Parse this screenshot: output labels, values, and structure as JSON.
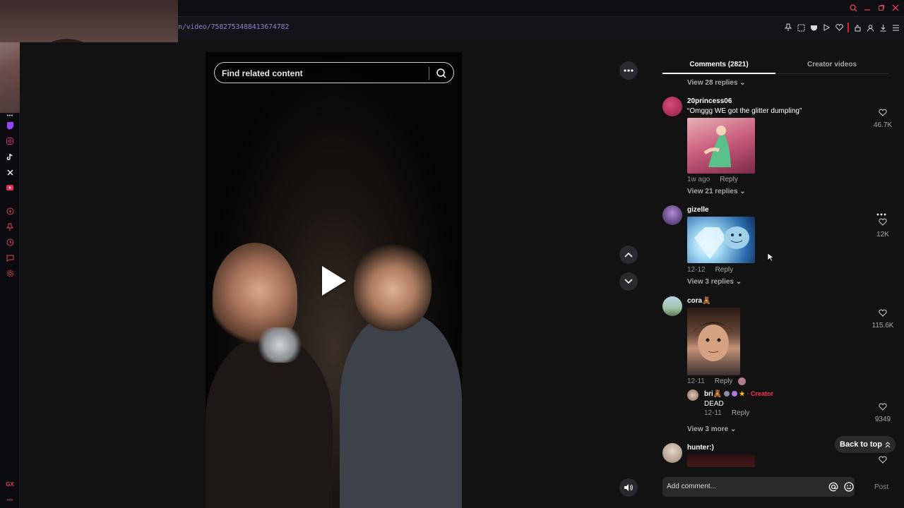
{
  "browser": {
    "url": "n/video/7582753488413674782"
  },
  "search": {
    "placeholder": "Find related content"
  },
  "panel": {
    "tabs": [
      {
        "label": "Comments (2821)",
        "active": true
      },
      {
        "label": "Creator videos",
        "active": false
      }
    ],
    "top_view_replies": "View 28 replies",
    "comments": [
      {
        "user": "20princess06",
        "text": "“Omggg WE got the glitter dumpling”",
        "time": "1w ago",
        "reply": "Reply",
        "likes": "46.7K",
        "view_replies": "View 21 replies"
      },
      {
        "user": "gizelle",
        "text": "",
        "time": "12-12",
        "reply": "Reply",
        "likes": "12K",
        "view_replies": "View 3 replies"
      },
      {
        "user": "cora🧸",
        "text": "",
        "time": "12-11",
        "reply": "Reply",
        "likes": "115.6K",
        "view_replies": "View 3 more",
        "subreply": {
          "user": "bri🧸",
          "badge": "· Creator",
          "text": "DEAD",
          "time": "12-11",
          "reply": "Reply",
          "likes": "9349"
        }
      },
      {
        "user": "hunter:)",
        "text": "",
        "likes": ""
      }
    ],
    "back_to_top": "Back to top",
    "composer": {
      "placeholder": "Add comment...",
      "post": "Post"
    }
  },
  "colors": {
    "accent": "#fe2c55",
    "url_text": "#8a84c7",
    "background": "#121212"
  }
}
